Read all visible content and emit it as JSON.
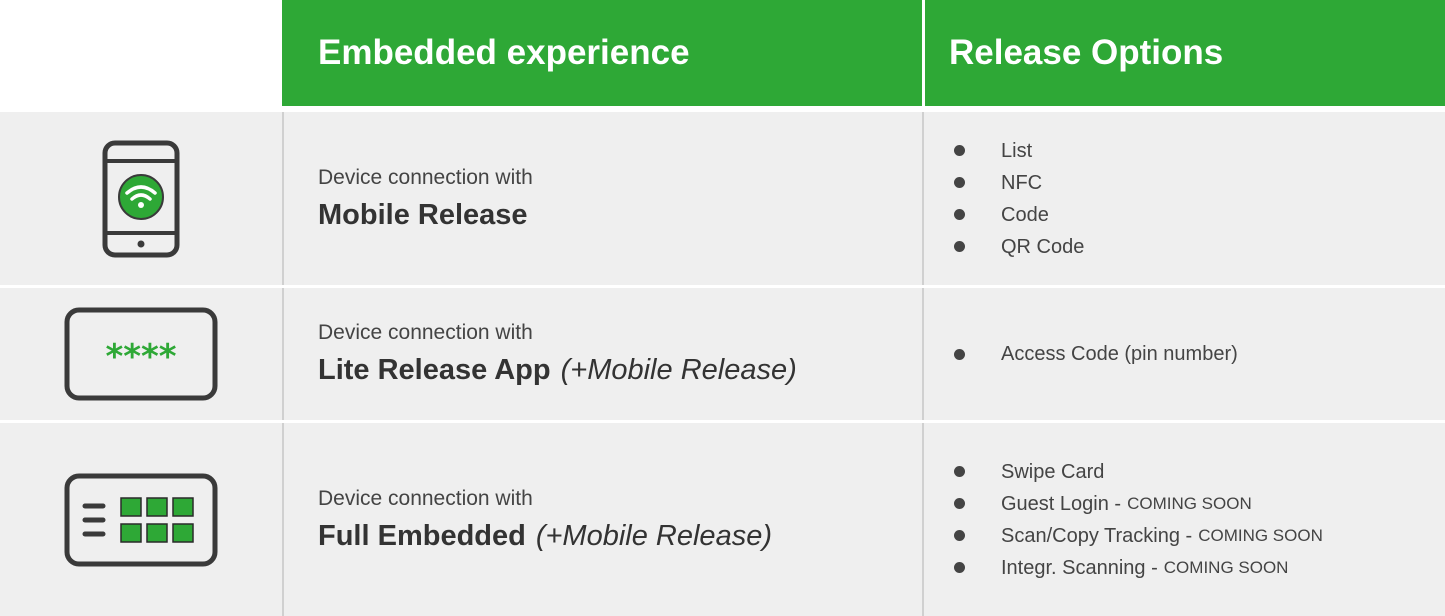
{
  "headers": {
    "embedded": "Embedded experience",
    "release": "Release Options"
  },
  "rows": [
    {
      "icon": "smartphone-wifi-icon",
      "prefix": "Device connection with",
      "product": "Mobile Release",
      "suffix": "",
      "options": [
        {
          "label": "List",
          "note": ""
        },
        {
          "label": "NFC",
          "note": ""
        },
        {
          "label": "Code",
          "note": ""
        },
        {
          "label": "QR Code",
          "note": ""
        }
      ]
    },
    {
      "icon": "pin-code-screen-icon",
      "icon_text": "****",
      "prefix": "Device connection with",
      "product": "Lite Release App",
      "suffix": "(+Mobile Release)",
      "options": [
        {
          "label": "Access Code (pin number)",
          "note": ""
        }
      ]
    },
    {
      "icon": "embedded-panel-icon",
      "prefix": "Device connection with",
      "product": "Full Embedded",
      "suffix": "(+Mobile Release)",
      "options": [
        {
          "label": "Swipe Card",
          "note": ""
        },
        {
          "label": "Guest Login -",
          "note": "COMING SOON"
        },
        {
          "label": "Scan/Copy Tracking  -",
          "note": "COMING SOON"
        },
        {
          "label": "Integr. Scanning -",
          "note": "COMING SOON"
        }
      ]
    }
  ],
  "colors": {
    "accent": "#2ea836",
    "row_bg": "#efefef",
    "icon_stroke": "#3a3a3a"
  }
}
